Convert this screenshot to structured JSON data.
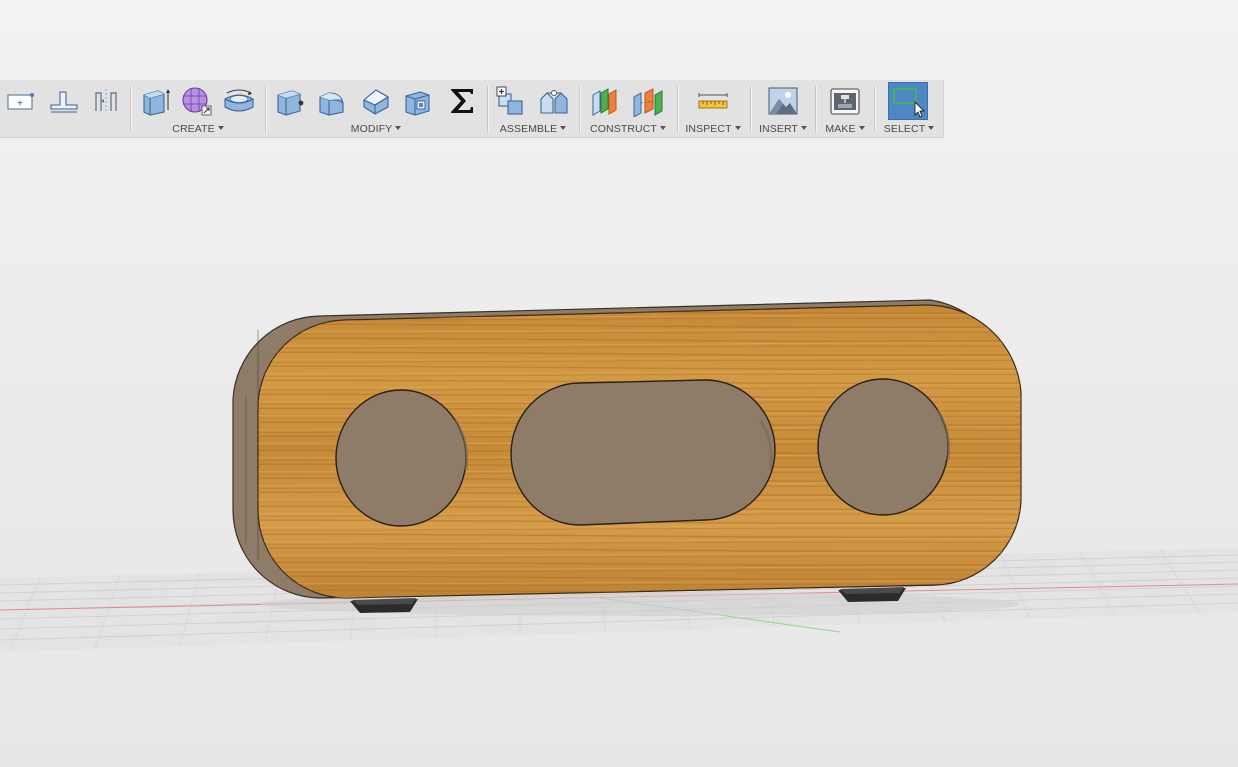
{
  "toolbar": {
    "groups": {
      "create": {
        "label": "CREATE"
      },
      "modify": {
        "label": "MODIFY"
      },
      "assemble": {
        "label": "ASSEMBLE"
      },
      "construct": {
        "label": "CONSTRUCT"
      },
      "inspect": {
        "label": "INSPECT"
      },
      "insert": {
        "label": "INSERT"
      },
      "make": {
        "label": "MAKE"
      },
      "select": {
        "label": "SELECT"
      }
    },
    "icons": {
      "sketch_rectangle": "sketch-rectangle-icon",
      "sketch_profile": "sketch-profile-icon",
      "sketch_mirror": "sketch-mirror-icon",
      "extrude": "extrude-icon",
      "form": "form-icon",
      "revolve": "revolve-icon",
      "press_pull": "press-pull-icon",
      "fillet": "fillet-icon",
      "chamfer": "chamfer-icon",
      "shell": "shell-icon",
      "parameters": "sigma-parameters-icon",
      "new_component": "new-component-icon",
      "joint": "joint-icon",
      "offset_plane": "offset-plane-icon",
      "midplane": "midplane-icon",
      "measure": "measure-icon",
      "insert_image": "insert-image-icon",
      "print_3d": "3d-print-icon",
      "window_select": "window-select-icon"
    }
  },
  "colors": {
    "wood_face": "#c98a3a",
    "wood_edge": "#8c7a66",
    "toolbar_bg": "#e2e2e2",
    "select_active": "#4f86c6",
    "grid_line": "#c9c9c9",
    "x_axis": "#e07a7a",
    "y_axis": "#8ad08a"
  }
}
